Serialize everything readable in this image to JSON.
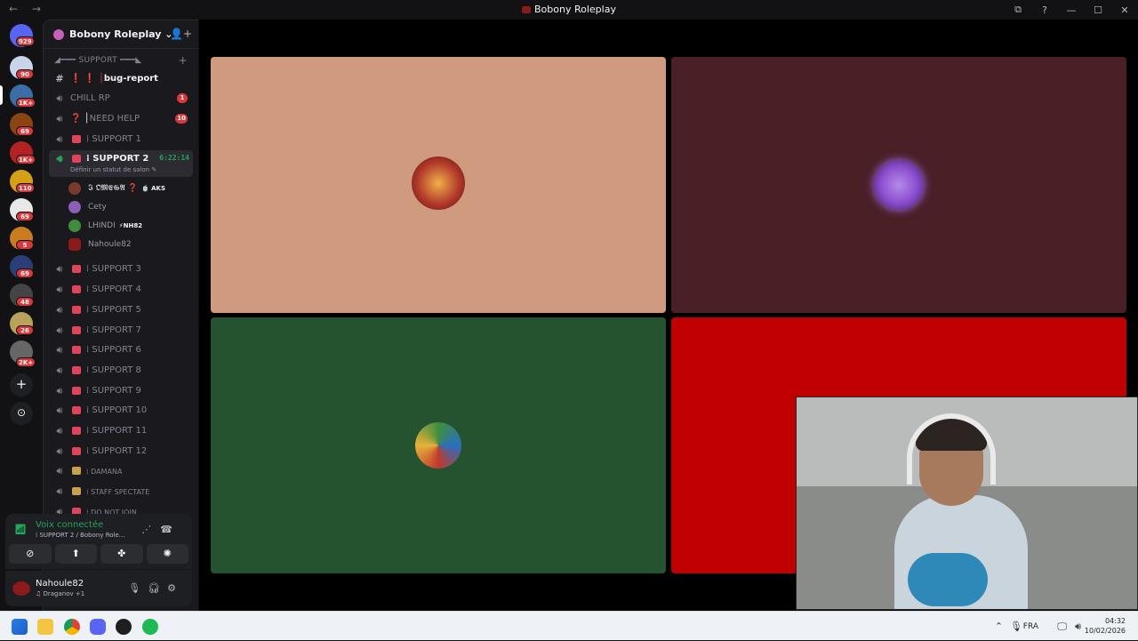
{
  "window": {
    "title": "Bobony Roleplay",
    "nav": "← →",
    "controls": [
      "⧉",
      "?",
      "—",
      "☐",
      "✕"
    ]
  },
  "guilds": [
    {
      "name": "direct-messages",
      "badge": "929",
      "color": "#5865f2"
    },
    {
      "name": "server-1",
      "badge": "90",
      "color": "#c8d4e8"
    },
    {
      "name": "server-2",
      "badge": "1K+",
      "color": "#3a6ea5"
    },
    {
      "name": "server-3",
      "badge": "69",
      "color": "#8b4513"
    },
    {
      "name": "server-4",
      "badge": "1K+",
      "color": "#b22222"
    },
    {
      "name": "server-5",
      "badge": "110",
      "color": "#d4a017"
    },
    {
      "name": "server-6",
      "badge": "69",
      "color": "#e8e8e8"
    },
    {
      "name": "server-7",
      "badge": "5",
      "color": "#c97c20"
    },
    {
      "name": "server-8",
      "badge": "69",
      "color": "#2a3f7a"
    },
    {
      "name": "server-9",
      "badge": "48",
      "color": "#444"
    },
    {
      "name": "server-10",
      "badge": "26",
      "color": "#b8a35a"
    },
    {
      "name": "server-11",
      "badge": "2K+",
      "color": "#666"
    }
  ],
  "server": {
    "name": "Bobony Roleplay",
    "category": "◢━━━ SUPPORT ━━━◣",
    "channels": [
      {
        "label": "bug-report",
        "type": "text",
        "prefix": "❗ ❗ │",
        "bold": true
      },
      {
        "label": "CHILL RP",
        "type": "voice",
        "badge": "1"
      },
      {
        "label": "NEED HELP",
        "type": "voice",
        "prefix": "❓ │",
        "badge": "10"
      },
      {
        "label": "SUPPORT 1",
        "type": "voice",
        "prefix": "⁞"
      },
      {
        "label": "SUPPORT 2",
        "type": "voice",
        "prefix": "⁞",
        "active": true,
        "timer": "6:22:14",
        "status": "Définir un statut de salon ✎"
      },
      {
        "label": "SUPPORT 3",
        "type": "voice",
        "prefix": "⁞"
      },
      {
        "label": "SUPPORT 4",
        "type": "voice",
        "prefix": "⁞"
      },
      {
        "label": "SUPPORT 5",
        "type": "voice",
        "prefix": "⁞"
      },
      {
        "label": "SUPPORT 7",
        "type": "voice",
        "prefix": "⁞"
      },
      {
        "label": "SUPPORT 6",
        "type": "voice",
        "prefix": "⁞"
      },
      {
        "label": "SUPPORT 8",
        "type": "voice",
        "prefix": "⁞"
      },
      {
        "label": "SUPPORT 9",
        "type": "voice",
        "prefix": "⁞"
      },
      {
        "label": "SUPPORT 10",
        "type": "voice",
        "prefix": "⁞"
      },
      {
        "label": "SUPPORT 11",
        "type": "voice",
        "prefix": "⁞"
      },
      {
        "label": "SUPPORT 12",
        "type": "voice",
        "prefix": "⁞"
      },
      {
        "label": "DAMANA",
        "type": "voice",
        "prefix": "⁞"
      },
      {
        "label": "STAFF SPECTATE",
        "type": "voice",
        "prefix": "⁞"
      },
      {
        "label": "DO NOT JOIN",
        "type": "voice",
        "prefix": "⁞"
      }
    ],
    "voice_users": [
      {
        "name": "𝕴 𝕺𝕸𝕰𝕲𝕬 ❓",
        "tag": "🍵 AKS",
        "color": "#7a3a2a"
      },
      {
        "name": "Cety",
        "tag": "",
        "color": "#8a5fb5"
      },
      {
        "name": "LHINDI",
        "tag": "⚡NH82",
        "color": "#3e8e3e"
      },
      {
        "name": "Nahoule82",
        "tag": "",
        "color": "#8b1a1a"
      }
    ]
  },
  "voice_panel": {
    "title": "Voix connectée",
    "subtitle": "⁞ SUPPORT 2 / Bobony Role...",
    "buttons": [
      "⊘",
      "⬆",
      "✤",
      "✺"
    ]
  },
  "user_panel": {
    "name": "Nahoule82",
    "status": "♫ Draganov +1"
  },
  "tiles": [
    {
      "name": "omega-tile",
      "bg": "#d09a7e",
      "avatar": "#b23a2a"
    },
    {
      "name": "cety-tile",
      "bg": "#4a1f26",
      "avatar": "#8e4fd0"
    },
    {
      "name": "lhindi-tile",
      "bg": "#26532f",
      "avatar": "#4a9a50"
    },
    {
      "name": "nahoule-tile",
      "bg": "#c00000",
      "avatar": ""
    }
  ],
  "taskbar": {
    "language": "FRA",
    "time": "04:32",
    "date": "10/02/2026",
    "apps": [
      "windows-start",
      "file-explorer",
      "chrome",
      "discord",
      "obs",
      "spotify"
    ]
  }
}
